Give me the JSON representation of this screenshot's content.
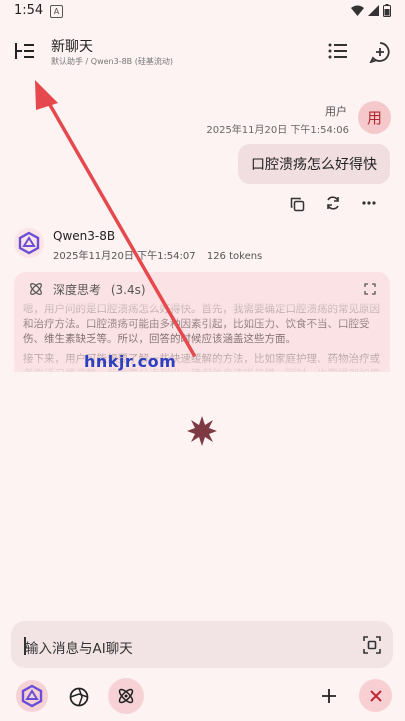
{
  "status_bar": {
    "time": "1:54",
    "notif_letter": "A"
  },
  "header": {
    "title": "新聊天",
    "subtitle": "默认助手 / Qwen3-8B (硅基流动)"
  },
  "user_message": {
    "name": "用户",
    "timestamp": "2025年11月20日 下午1:54:06",
    "avatar_text": "用",
    "text": "口腔溃疡怎么好得快"
  },
  "assistant": {
    "model": "Qwen3-8B",
    "timestamp": "2025年11月20日 下午1:54:07",
    "tokens": "126 tokens",
    "thinking_label": "深度思考",
    "thinking_time": "(3.4s)",
    "thinking_paragraphs": [
      "嗯，用户问的是口腔溃疡怎么好得快。首先，我需要确定口腔溃疡的常见原因和治疗方法。口腔溃疡可能由多种因素引起，比如压力、饮食不当、口腔受伤、维生素缺乏等。所以，回答的时候应该涵盖这些方面。",
      "接下来，用户可能想要了解一些快速缓解的方法，比如家庭护理、药物治疗或者生活习惯调整。我需要分点列出，确保信息清晰易懂。同时，也要提到如果溃疡长期不愈合，应该就医，因为可能有更严重的病因。"
    ]
  },
  "watermark": "hnkjr.com",
  "input": {
    "placeholder": "输入消息与AI聊天"
  },
  "colors": {
    "background": "#fdf3f3",
    "accent": "#c02a35",
    "card": "#fbe3e5",
    "arrow": "#e5484d"
  }
}
